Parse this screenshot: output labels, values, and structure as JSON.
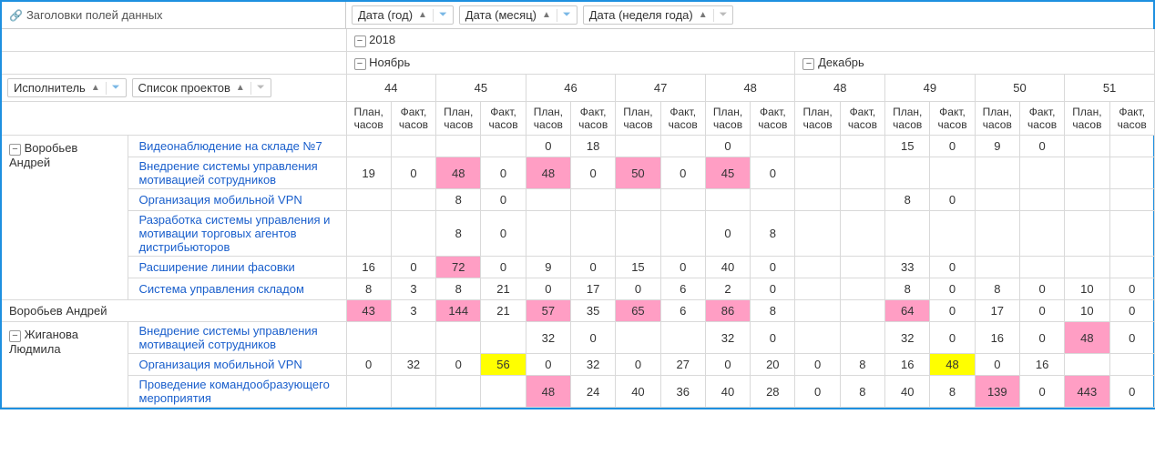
{
  "header": {
    "data_fields_label": "Заголовки полей данных"
  },
  "col_fields": [
    {
      "label": "Дата (год)",
      "funnel_active": true
    },
    {
      "label": "Дата (месяц)",
      "funnel_active": true
    },
    {
      "label": "Дата (неделя года)",
      "funnel_active": false
    }
  ],
  "row_fields": [
    {
      "label": "Исполнитель",
      "funnel_active": true
    },
    {
      "label": "Список проектов",
      "funnel_active": false
    }
  ],
  "year": "2018",
  "months": [
    {
      "name": "Ноябрь",
      "weeks": [
        "44",
        "45",
        "46",
        "47",
        "48"
      ]
    },
    {
      "name": "Декабрь",
      "weeks": [
        "48",
        "49",
        "50",
        "51"
      ]
    }
  ],
  "measures": {
    "plan": "План, часов",
    "fact": "Факт, часов"
  },
  "executors": [
    {
      "name": "Воробьев Андрей",
      "projects": [
        {
          "name": "Видеонаблюдение на складе №7",
          "cells": [
            {},
            {},
            {},
            {},
            {
              "v": "0"
            },
            {
              "v": "18"
            },
            {},
            {},
            {
              "v": "0"
            },
            {},
            {},
            {},
            {
              "v": "15"
            },
            {
              "v": "0"
            },
            {
              "v": "9"
            },
            {
              "v": "0"
            },
            {},
            {}
          ]
        },
        {
          "name": "Внедрение системы управления мотивацией сотрудников",
          "cells": [
            {
              "v": "19"
            },
            {
              "v": "0"
            },
            {
              "v": "48",
              "c": "pink"
            },
            {
              "v": "0"
            },
            {
              "v": "48",
              "c": "pink"
            },
            {
              "v": "0"
            },
            {
              "v": "50",
              "c": "pink"
            },
            {
              "v": "0"
            },
            {
              "v": "45",
              "c": "pink"
            },
            {
              "v": "0"
            },
            {},
            {},
            {},
            {},
            {},
            {},
            {},
            {}
          ]
        },
        {
          "name": "Организация мобильной VPN",
          "cells": [
            {},
            {},
            {
              "v": "8"
            },
            {
              "v": "0"
            },
            {},
            {},
            {},
            {},
            {},
            {},
            {},
            {},
            {
              "v": "8"
            },
            {
              "v": "0"
            },
            {},
            {},
            {},
            {}
          ]
        },
        {
          "name": "Разработка системы управления и мотивации торговых агентов дистрибьюторов",
          "cells": [
            {},
            {},
            {
              "v": "8"
            },
            {
              "v": "0"
            },
            {},
            {},
            {},
            {},
            {
              "v": "0"
            },
            {
              "v": "8"
            },
            {},
            {},
            {},
            {},
            {},
            {},
            {},
            {}
          ]
        },
        {
          "name": "Расширение линии фасовки",
          "cells": [
            {
              "v": "16"
            },
            {
              "v": "0"
            },
            {
              "v": "72",
              "c": "pink"
            },
            {
              "v": "0"
            },
            {
              "v": "9"
            },
            {
              "v": "0"
            },
            {
              "v": "15"
            },
            {
              "v": "0"
            },
            {
              "v": "40"
            },
            {
              "v": "0"
            },
            {},
            {},
            {
              "v": "33"
            },
            {
              "v": "0"
            },
            {},
            {},
            {},
            {}
          ]
        },
        {
          "name": "Система управления складом",
          "cells": [
            {
              "v": "8"
            },
            {
              "v": "3"
            },
            {
              "v": "8"
            },
            {
              "v": "21"
            },
            {
              "v": "0"
            },
            {
              "v": "17"
            },
            {
              "v": "0"
            },
            {
              "v": "6"
            },
            {
              "v": "2"
            },
            {
              "v": "0"
            },
            {},
            {},
            {
              "v": "8"
            },
            {
              "v": "0"
            },
            {
              "v": "8"
            },
            {
              "v": "0"
            },
            {
              "v": "10"
            },
            {
              "v": "0"
            }
          ]
        }
      ],
      "total": {
        "label": "Воробьев Андрей",
        "cells": [
          {
            "v": "43",
            "c": "pink"
          },
          {
            "v": "3"
          },
          {
            "v": "144",
            "c": "pink"
          },
          {
            "v": "21"
          },
          {
            "v": "57",
            "c": "pink"
          },
          {
            "v": "35"
          },
          {
            "v": "65",
            "c": "pink"
          },
          {
            "v": "6"
          },
          {
            "v": "86",
            "c": "pink"
          },
          {
            "v": "8"
          },
          {},
          {},
          {
            "v": "64",
            "c": "pink"
          },
          {
            "v": "0"
          },
          {
            "v": "17"
          },
          {
            "v": "0"
          },
          {
            "v": "10"
          },
          {
            "v": "0"
          }
        ]
      }
    },
    {
      "name": "Жиганова Людмила",
      "projects": [
        {
          "name": "Внедрение системы управления мотивацией сотрудников",
          "cells": [
            {},
            {},
            {},
            {},
            {
              "v": "32"
            },
            {
              "v": "0"
            },
            {},
            {},
            {
              "v": "32"
            },
            {
              "v": "0"
            },
            {},
            {},
            {
              "v": "32"
            },
            {
              "v": "0"
            },
            {
              "v": "16"
            },
            {
              "v": "0"
            },
            {
              "v": "48",
              "c": "pink"
            },
            {
              "v": "0"
            }
          ]
        },
        {
          "name": "Организация мобильной VPN",
          "cells": [
            {
              "v": "0"
            },
            {
              "v": "32"
            },
            {
              "v": "0"
            },
            {
              "v": "56",
              "c": "yellow"
            },
            {
              "v": "0"
            },
            {
              "v": "32"
            },
            {
              "v": "0"
            },
            {
              "v": "27"
            },
            {
              "v": "0"
            },
            {
              "v": "20"
            },
            {
              "v": "0"
            },
            {
              "v": "8"
            },
            {
              "v": "16"
            },
            {
              "v": "48",
              "c": "yellow"
            },
            {
              "v": "0"
            },
            {
              "v": "16"
            },
            {},
            {}
          ]
        },
        {
          "name": "Проведение командообразующего мероприятия",
          "cells": [
            {},
            {},
            {},
            {},
            {
              "v": "48",
              "c": "pink"
            },
            {
              "v": "24"
            },
            {
              "v": "40"
            },
            {
              "v": "36"
            },
            {
              "v": "40"
            },
            {
              "v": "28"
            },
            {
              "v": "0"
            },
            {
              "v": "8"
            },
            {
              "v": "40"
            },
            {
              "v": "8"
            },
            {
              "v": "139",
              "c": "pink"
            },
            {
              "v": "0"
            },
            {
              "v": "443",
              "c": "pink"
            },
            {
              "v": "0"
            }
          ]
        }
      ]
    }
  ]
}
